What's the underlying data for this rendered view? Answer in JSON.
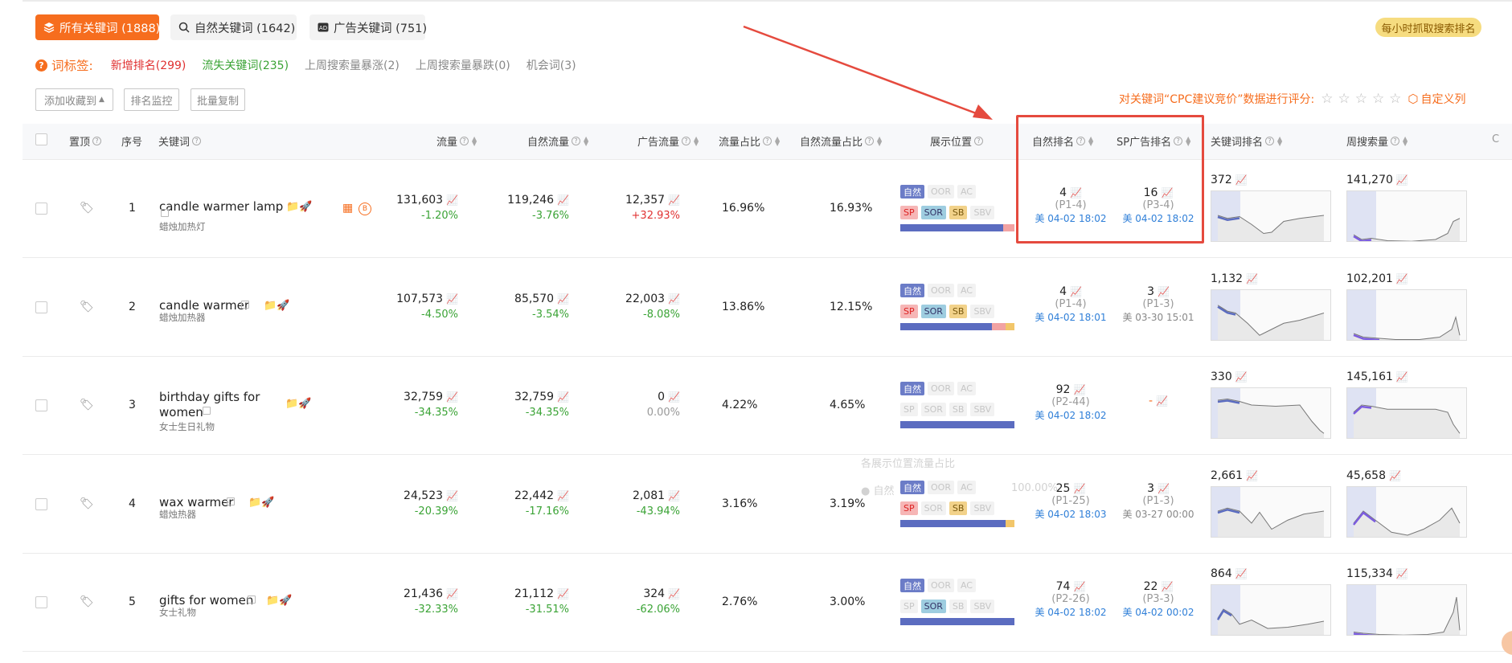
{
  "tabs": [
    {
      "label": "所有关键词 (1888)",
      "icon": "layers-icon"
    },
    {
      "label": "自然关键词 (1642)",
      "icon": "search-icon"
    },
    {
      "label": "广告关键词 (751)",
      "icon": "ad-icon"
    }
  ],
  "hourly_badge": "每小时抓取搜索排名",
  "tag_label": "词标签:",
  "tags": [
    {
      "label": "新增排名(299)",
      "color": "#e03232"
    },
    {
      "label": "流失关键词(235)",
      "color": "#3aa335"
    },
    {
      "label": "上周搜索量暴涨(2)",
      "color": "#888"
    },
    {
      "label": "上周搜索量暴跌(0)",
      "color": "#888"
    },
    {
      "label": "机会词(3)",
      "color": "#888"
    }
  ],
  "buttons": {
    "add_fav": "添加收藏到",
    "rank_monitor": "排名监控",
    "batch_copy": "批量复制"
  },
  "cpc_text": "对关键词“CPC建议竞价”数据进行评分:",
  "custom_col": "自定义列",
  "headers": {
    "top": "置顶",
    "index": "序号",
    "keyword": "关键词",
    "traffic": "流量",
    "natural_traffic": "自然流量",
    "ad_traffic": "广告流量",
    "traffic_share": "流量占比",
    "natural_share": "自然流量占比",
    "display": "展示位置",
    "natural_rank": "自然排名",
    "sp_rank": "SP广告排名",
    "kw_rank": "关键词排名",
    "weekly_search": "周搜索量"
  },
  "pills": {
    "nat": "自然",
    "oor": "OOR",
    "ac": "AC",
    "sp": "SP",
    "sor": "SOR",
    "sb": "SB",
    "sbv": "SBV"
  },
  "ghost": {
    "title": "各展示位置流量占比",
    "legend": "自然",
    "pct": "100.00%"
  },
  "rows": [
    {
      "idx": "1",
      "kw": "candle warmer lamp",
      "cn": "蜡烛加热灯",
      "traffic": "131,603",
      "traffic_chg": "-1.20%",
      "nat": "119,246",
      "nat_chg": "-3.76%",
      "ad": "12,357",
      "ad_chg": "+32.93%",
      "share": "16.96%",
      "nat_share": "16.93%",
      "nrank": "4",
      "nrank_sub": "(P1-4)",
      "nrank_time": "美 04-02 18:02",
      "sprank": "16",
      "sprank_sub": "(P3-4)",
      "sprank_time": "美 04-02 18:02",
      "kwrank": "372",
      "weekly": "141,270"
    },
    {
      "idx": "2",
      "kw": "candle warmer",
      "cn": "蜡烛加热器",
      "traffic": "107,573",
      "traffic_chg": "-4.50%",
      "nat": "85,570",
      "nat_chg": "-3.54%",
      "ad": "22,003",
      "ad_chg": "-8.08%",
      "share": "13.86%",
      "nat_share": "12.15%",
      "nrank": "4",
      "nrank_sub": "(P1-4)",
      "nrank_time": "美 04-02 18:01",
      "sprank": "3",
      "sprank_sub": "(P1-3)",
      "sprank_time": "美 03-30 15:01",
      "kwrank": "1,132",
      "weekly": "102,201"
    },
    {
      "idx": "3",
      "kw": "birthday gifts for",
      "kw2": "women",
      "cn": "女士生日礼物",
      "traffic": "32,759",
      "traffic_chg": "-34.35%",
      "nat": "32,759",
      "nat_chg": "-34.35%",
      "ad": "0",
      "ad_chg": "0.00%",
      "share": "4.22%",
      "nat_share": "4.65%",
      "nrank": "92",
      "nrank_sub": "(P2-44)",
      "nrank_time": "美 04-02 18:02",
      "sprank": "-",
      "sprank_sub": "",
      "sprank_time": "",
      "kwrank": "330",
      "weekly": "145,161"
    },
    {
      "idx": "4",
      "kw": "wax warmer",
      "cn": "蜡烛热器",
      "traffic": "24,523",
      "traffic_chg": "-20.39%",
      "nat": "22,442",
      "nat_chg": "-17.16%",
      "ad": "2,081",
      "ad_chg": "-43.94%",
      "share": "3.16%",
      "nat_share": "3.19%",
      "nrank": "25",
      "nrank_sub": "(P1-25)",
      "nrank_time": "美 04-02 18:03",
      "sprank": "3",
      "sprank_sub": "(P1-3)",
      "sprank_time": "美 03-27 00:00",
      "kwrank": "2,661",
      "weekly": "45,658"
    },
    {
      "idx": "5",
      "kw": "gifts for women",
      "cn": "女士礼物",
      "traffic": "21,436",
      "traffic_chg": "-32.33%",
      "nat": "21,112",
      "nat_chg": "-31.51%",
      "ad": "324",
      "ad_chg": "-62.06%",
      "share": "2.76%",
      "nat_share": "3.00%",
      "nrank": "74",
      "nrank_sub": "(P2-26)",
      "nrank_time": "美 04-02 18:02",
      "sprank": "22",
      "sprank_sub": "(P3-3)",
      "sprank_time": "美 04-02 00:02",
      "kwrank": "864",
      "weekly": "115,334"
    }
  ]
}
